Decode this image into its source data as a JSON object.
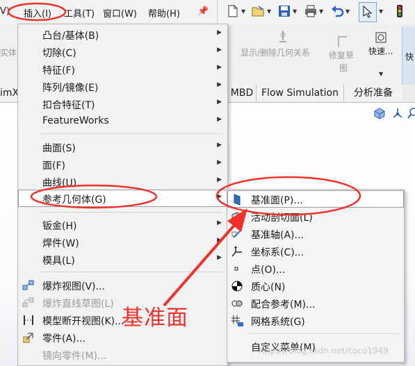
{
  "menubar": {
    "partial_left": "V)",
    "insert": "插入(I)",
    "tools": "工具(T)",
    "window": "窗口(W)",
    "help": "帮助(H)"
  },
  "ribbon": {
    "left_partial": "实体(",
    "show_delete_relations": "显示/删除几何关系",
    "repair_sketch_line1": "修复草",
    "repair_sketch_line2": "图",
    "quick": "快速...",
    "far_right": "快"
  },
  "tabs": {
    "left_partial": "imX",
    "mbd": "MBD",
    "flow_simulation": "Flow Simulation",
    "analysis_prep": "分析准备"
  },
  "insert_menu": {
    "items": [
      {
        "label": "凸台/基体(B)",
        "submenu": true
      },
      {
        "label": "切除(C)",
        "submenu": true
      },
      {
        "label": "特征(F)",
        "submenu": true
      },
      {
        "label": "阵列/镜像(E)",
        "submenu": true
      },
      {
        "label": "扣合特征(T)",
        "submenu": true
      },
      {
        "label": "FeatureWorks",
        "submenu": true
      },
      {
        "label": "曲面(S)",
        "submenu": true
      },
      {
        "label": "面(F)",
        "submenu": true
      },
      {
        "label": "曲线(U)",
        "submenu": true
      },
      {
        "label": "参考几何体(G)",
        "submenu": true
      },
      {
        "label": "钣金(H)",
        "submenu": true
      },
      {
        "label": "焊件(W)",
        "submenu": true
      },
      {
        "label": "模具(L)",
        "submenu": true
      },
      {
        "label": "爆炸视图(V)...",
        "icon": "explode-view-icon"
      },
      {
        "label": "爆炸直线草图(L)",
        "icon": "explode-line-sketch-icon",
        "disabled": true
      },
      {
        "label": "模型断开视图(K)...",
        "icon": "model-break-view-icon"
      },
      {
        "label": "零件(A)...",
        "icon": "part-icon"
      },
      {
        "label": "镜向零件(M)...",
        "disabled": true
      }
    ]
  },
  "reference_geometry_submenu": {
    "items": [
      {
        "label": "基准面(P)...",
        "icon": "plane-icon"
      },
      {
        "label": "活动剖切面(L)",
        "icon": "live-section-plane-icon"
      },
      {
        "label": "基准轴(A)...",
        "icon": "axis-icon"
      },
      {
        "label": "坐标系(C)...",
        "icon": "coordinate-system-icon"
      },
      {
        "label": "点(O)...",
        "icon": "point-icon"
      },
      {
        "label": "质心(N)",
        "icon": "center-of-mass-icon"
      },
      {
        "label": "配合参考(M)...",
        "icon": "mate-reference-icon"
      },
      {
        "label": "网格系统(G)",
        "icon": "grid-system-icon"
      },
      {
        "label": "自定义菜单(M)"
      }
    ]
  },
  "annotation": {
    "text": "基准面",
    "color": "#f0302b"
  },
  "watermark": "https://blog.csdn.net/coco1949"
}
